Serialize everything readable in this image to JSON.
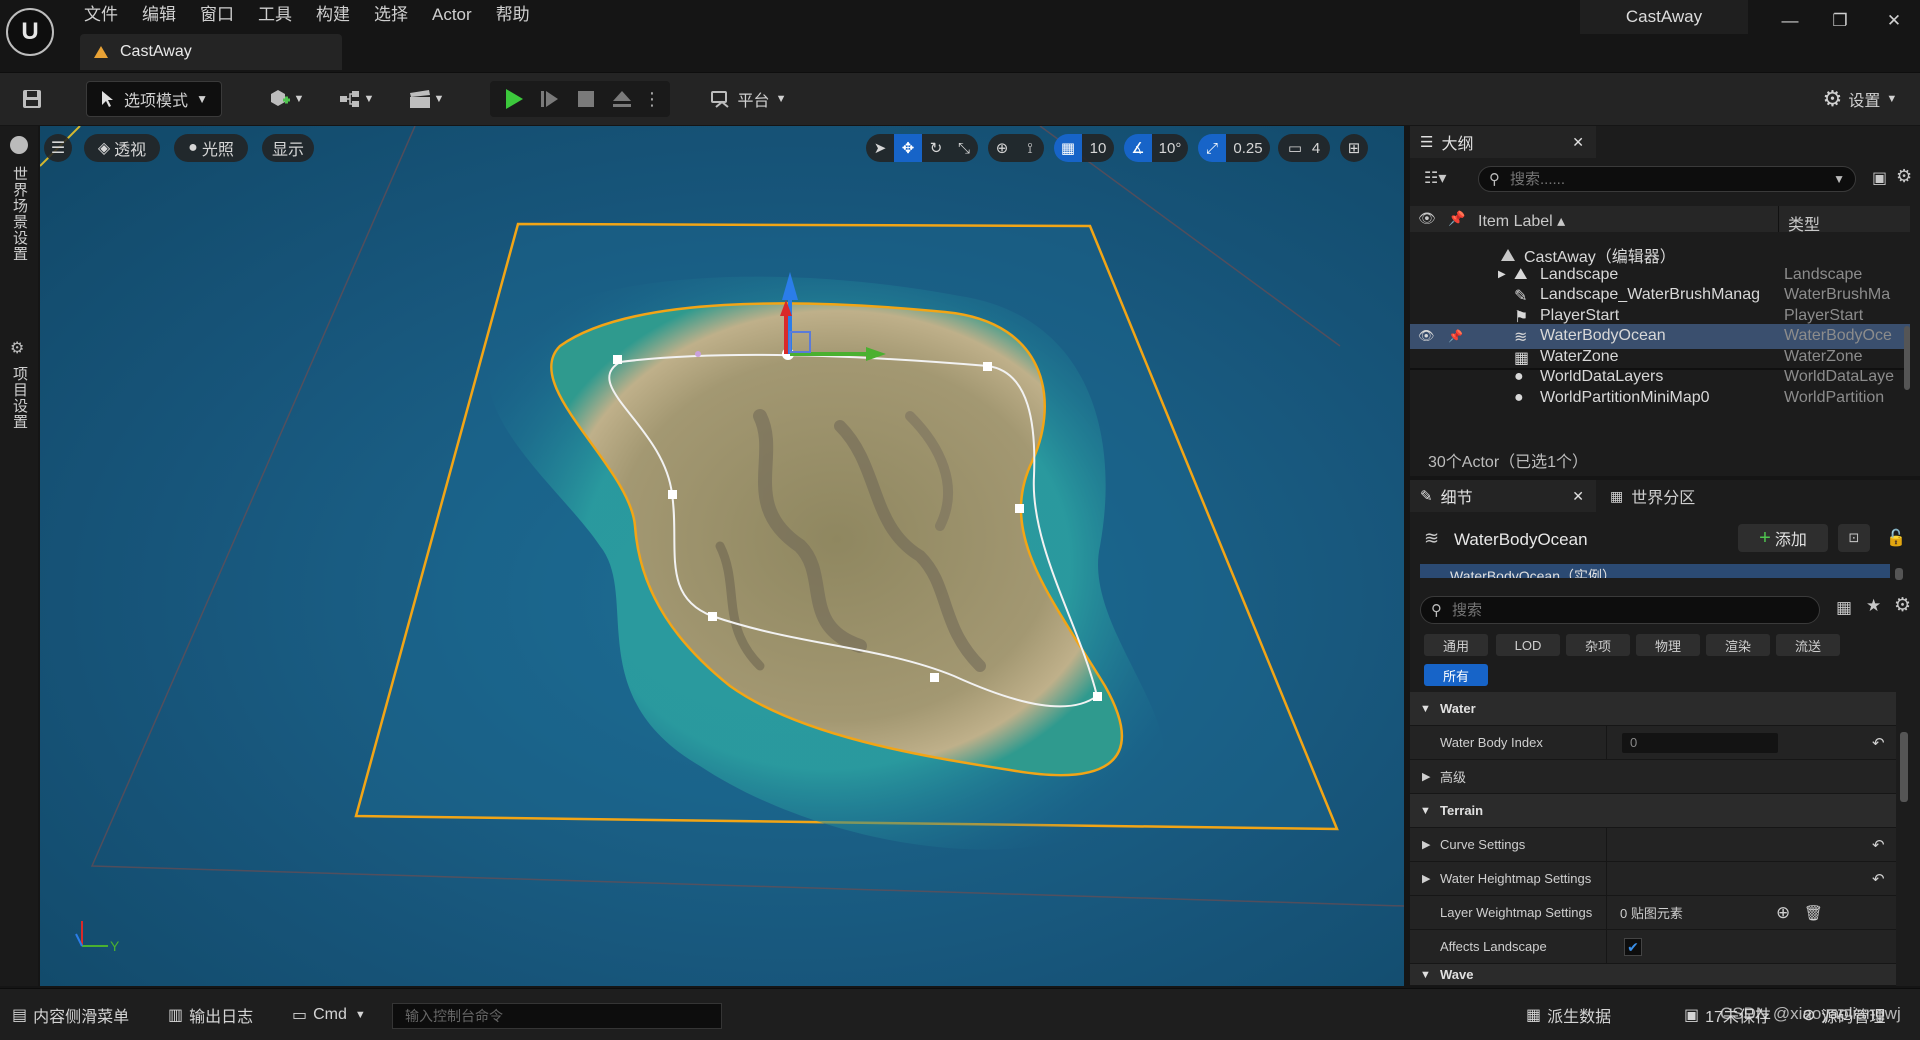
{
  "menu": [
    "文件",
    "编辑",
    "窗口",
    "工具",
    "构建",
    "选择",
    "Actor",
    "帮助"
  ],
  "logo_glyph": "U",
  "doc_tab": "CastAway",
  "project_name": "CastAway",
  "window_controls": {
    "minimize": "—",
    "restore": "❐",
    "close": "✕"
  },
  "toolbar": {
    "mode": "选项模式",
    "platform": "平台",
    "settings": "设置"
  },
  "left_strip": {
    "world_settings": "世界场景设置",
    "project_settings": "项目设置"
  },
  "viewport": {
    "view_mode": "透视",
    "lighting": "光照",
    "show": "显示",
    "grid_snap": "10",
    "rotation_snap": "10°",
    "scale_snap": "0.25",
    "camera_speed": "4",
    "axis_y": "Y",
    "colors": {
      "ocean": "#1a5f85",
      "bound": "#f2a516",
      "sand": "#a89a6a"
    }
  },
  "outliner": {
    "tab": "大纲",
    "search_placeholder": "搜索......",
    "col_label": "Item Label ▴",
    "col_type": "类型",
    "root": "CastAway（编辑器）",
    "items": [
      {
        "name": "Landscape",
        "type": "Landscape",
        "icon": "landscape-icon"
      },
      {
        "name": "Landscape_WaterBrushManag",
        "type": "WaterBrushMa",
        "icon": "brush-icon"
      },
      {
        "name": "PlayerStart",
        "type": "PlayerStart",
        "icon": "flag-icon"
      },
      {
        "name": "WaterBodyOcean",
        "type": "WaterBodyOce",
        "icon": "water-icon",
        "selected": true
      },
      {
        "name": "WaterZone",
        "type": "WaterZone",
        "icon": "zone-icon"
      },
      {
        "name": "WorldDataLayers",
        "type": "WorldDataLaye",
        "icon": "sphere-icon"
      },
      {
        "name": "WorldPartitionMiniMap0",
        "type": "WorldPartition",
        "icon": "sphere-icon"
      }
    ],
    "footer": "30个Actor（已选1个）"
  },
  "details": {
    "tab": "细节",
    "tab2": "世界分区",
    "actor_name": "WaterBodyOcean",
    "add_button": "添加",
    "instance_label": "WaterBodyOcean（实例）",
    "search_placeholder": "搜索",
    "filters": [
      "通用",
      "LOD",
      "杂项",
      "物理",
      "渲染",
      "流送"
    ],
    "filter_all": "所有",
    "sections": {
      "water": "Water",
      "water_body_index_label": "Water Body Index",
      "water_body_index_value": "0",
      "advanced": "高级",
      "terrain": "Terrain",
      "curve_settings": "Curve Settings",
      "water_heightmap": "Water Heightmap Settings",
      "layer_weightmap": "Layer Weightmap Settings",
      "layer_weightmap_value": "0 贴图元素",
      "affects_landscape": "Affects Landscape",
      "wave": "Wave"
    }
  },
  "statusbar": {
    "content_drawer": "内容侧滑菜单",
    "output_log": "输出日志",
    "cmd": "Cmd",
    "console_placeholder": "输入控制台命令",
    "derived_data": "派生数据",
    "unsaved": "17未保存",
    "source_control": "源码管理"
  },
  "watermark": "CSDN @xiaoyaoliangwj"
}
